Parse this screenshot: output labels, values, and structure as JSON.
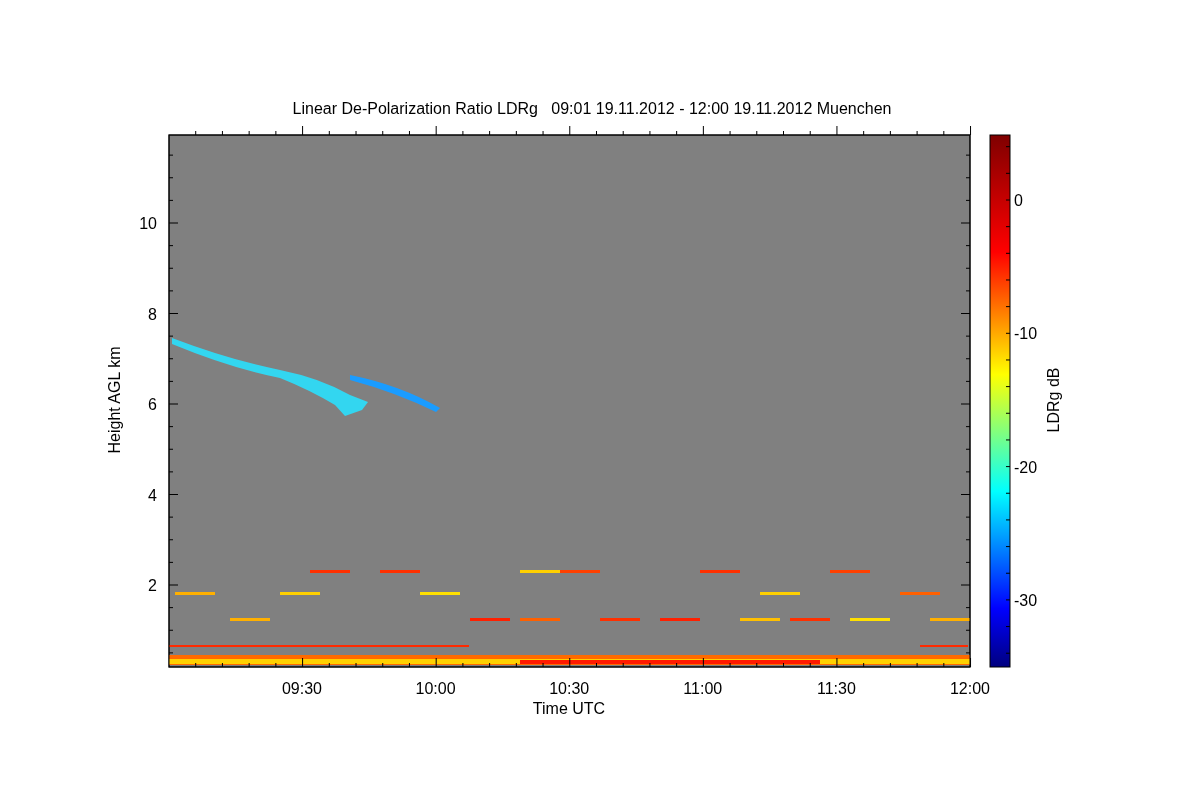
{
  "title": "Linear De-Polarization Ratio LDRg   09:01 19.11.2012 - 12:00 19.11.2012 Muenchen",
  "plot": {
    "ylabel": "Height AGL km",
    "yticks": [
      "10",
      "8",
      "6",
      "4",
      "2"
    ],
    "xlabel": "Time UTC",
    "xticks": [
      "09:30",
      "10:00",
      "10:30",
      "11:00",
      "11:30",
      "12:00"
    ]
  },
  "colorbar": {
    "label": "LDRg dB",
    "ticks": [
      "0",
      "-10",
      "-20",
      "-30"
    ]
  }
}
